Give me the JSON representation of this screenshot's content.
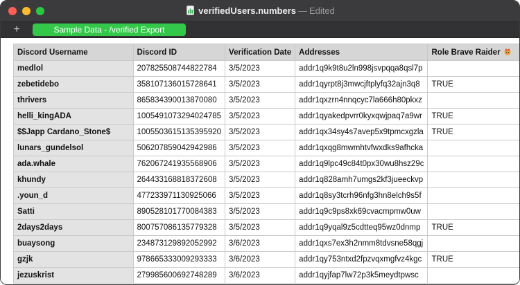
{
  "window": {
    "filename": "verifiedUsers.numbers",
    "separator": "—",
    "status": "Edited"
  },
  "tabs": {
    "add_label": "+",
    "active_tab": "Sample Data - /verified Export"
  },
  "table": {
    "headers": [
      "Discord Username",
      "Discord ID",
      "Verification Date",
      "Addresses",
      "Role Brave Raider"
    ],
    "rows": [
      [
        "medlol",
        "207825508744822784",
        "3/5/2023",
        "addr1q9k9t8u2ln998jsvpqqa8qsl7p",
        ""
      ],
      [
        "zebetidebo",
        "358107136015728641",
        "3/5/2023",
        "addr1qyrpt8j3mwcjftplyfq32ajn3q8",
        "TRUE"
      ],
      [
        "thrivers",
        "865834390013870080",
        "3/5/2023",
        "addr1qxzrn4nnqcyc7la666h80pkxz",
        ""
      ],
      [
        "helli_kingADA",
        "1005491073294024785",
        "3/5/2023",
        "addr1qyakedpvrr0kyxqwjpaq7a9wr",
        "TRUE"
      ],
      [
        "$$Japp Cardano_Stone$",
        "1005503615135395920",
        "3/5/2023",
        "addr1qx34sy4s7avep5x9tpmcxgzla",
        "TRUE"
      ],
      [
        "lunars_gundelsol",
        "506207859042942986",
        "3/5/2023",
        "addr1qxqg8mwmhtvfwxdks9afhcka",
        ""
      ],
      [
        "ada.whale",
        "762067241935568906",
        "3/5/2023",
        "addr1q9lpc49c84t0px30wu8hsz29c",
        ""
      ],
      [
        "khundy",
        "264433168818372608",
        "3/5/2023",
        "addr1q828amh7umgs2kf3jueeckvp",
        ""
      ],
      [
        ".youn_d",
        "477233971130925066",
        "3/5/2023",
        "addr1q8sy3tcrh96nfg3hn8elch9s5f",
        ""
      ],
      [
        "Satti",
        "890528101770084383",
        "3/5/2023",
        "addr1q9c9ps8xk69cvacmpmw0uw",
        ""
      ],
      [
        "2days2days",
        "800757086135779328",
        "3/5/2023",
        "addr1q9yqal9z5cdtteq95wz0dnmp",
        "TRUE"
      ],
      [
        "buaysong",
        "234873129892052992",
        "3/6/2023",
        "addr1qxs7ex3h2nmm8tdvsne58qgj",
        ""
      ],
      [
        "gzjk",
        "978665333009293333",
        "3/6/2023",
        "addr1qy753ntxd2fpzvqxmgfvz4kgc",
        "TRUE"
      ],
      [
        "jezuskrist",
        "279985600692748289",
        "3/6/2023",
        "addr1qyjfap7lw72p3k5meydtpwsc",
        ""
      ]
    ]
  },
  "colors": {
    "active_tab": "#33c84a",
    "header_bg": "#d6d6d6",
    "row_header_bg": "#e3e3e3"
  },
  "icons": {
    "header_role": "raider-emoji-icon",
    "document": "numbers-document-icon"
  }
}
